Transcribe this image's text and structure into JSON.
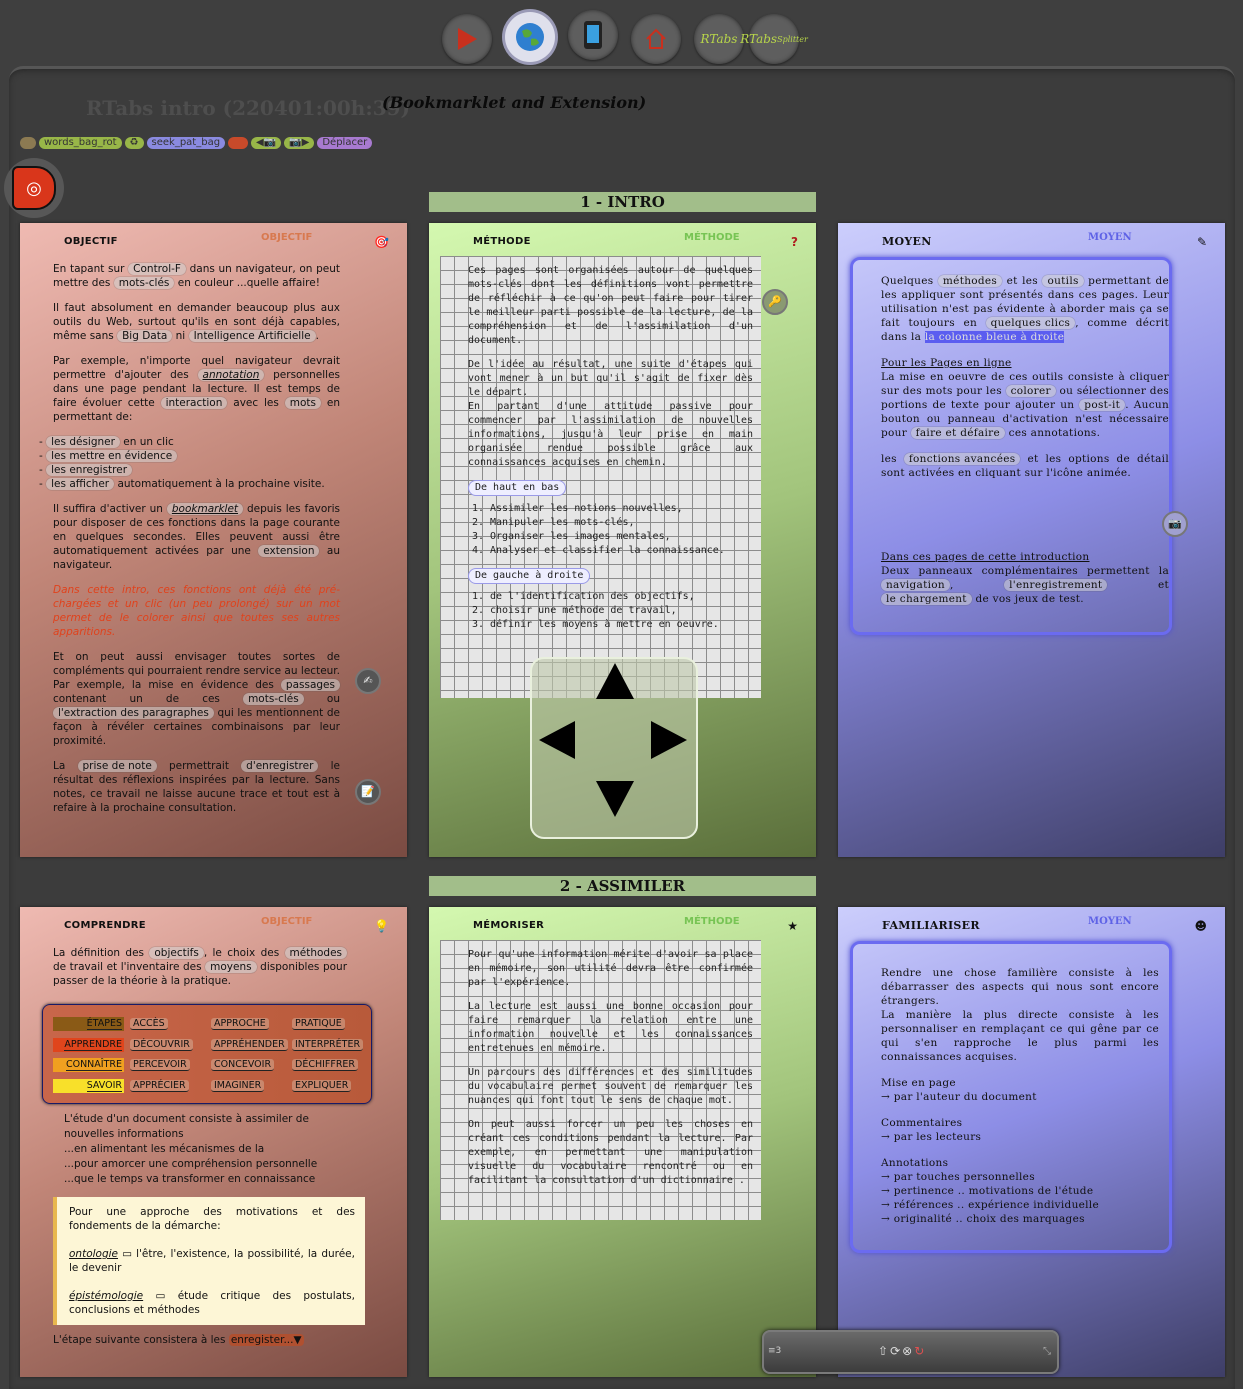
{
  "toolbar": {
    "buttons": [
      {
        "name": "play-button",
        "icon": "play-icon",
        "label": ""
      },
      {
        "name": "globe-button",
        "icon": "globe-icon",
        "label": ""
      },
      {
        "name": "phone-button",
        "icon": "phone-icon",
        "label": ""
      },
      {
        "name": "home-button",
        "icon": "home-icon",
        "label": ""
      },
      {
        "name": "rtabs-button",
        "label": "RTabs"
      },
      {
        "name": "rtabs-splitter-button",
        "label": "RTabs",
        "sup": "Splitter"
      }
    ]
  },
  "header": {
    "title": "RTabs intro (220401:00h:39)",
    "subtitle": "(Bookmarklet and Extension)"
  },
  "pillbar": {
    "words_bag": "words_bag_rot",
    "seek_pat": "seek_pat_bag",
    "move": "Déplacer"
  },
  "sections": {
    "s1": "1 - INTRO",
    "s2": "2 - ASSIMILER"
  },
  "panel_objectif": {
    "head": "OBJECTIF",
    "tag": "OBJECTIF",
    "p1a": "En tapant sur",
    "p1chip1": "Control-F",
    "p1b": "dans un navigateur, on peut mettre des",
    "p1chip2": "mots-clés",
    "p1c": "en couleur ...quelle affaire!",
    "p2a": "Il faut absolument en demander beaucoup plus aux outils du Web, surtout qu'ils en sont déjà capables, même sans",
    "p2chip1": "Big Data",
    "p2b": "ni",
    "p2chip2": "Intelligence Artificielle",
    "p2c": ".",
    "p3a": "Par exemple, n'importe quel navigateur devrait permettre d'ajouter des",
    "p3chip1": "annotation",
    "p3b": "personnelles dans une page pendant la lecture. Il est temps de faire évoluer cette",
    "p3chip2": "interaction",
    "p3c": "avec les",
    "p3chip3": "mots",
    "p3d": "en permettant de:",
    "list": [
      {
        "chip": "les désigner",
        "rest": "en un clic"
      },
      {
        "chip": "les mettre en évidence",
        "rest": ""
      },
      {
        "chip": "les enregistrer",
        "rest": ""
      },
      {
        "chip": "les afficher",
        "rest": "automatiquement à la prochaine visite."
      }
    ],
    "p4a": "Il suffira d'activer un",
    "p4chip1": "bookmarklet",
    "p4b": "depuis les favoris pour disposer de ces fonctions dans la page courante en quelques secondes. Elles peuvent aussi être automatiquement activées par une",
    "p4chip2": "extension",
    "p4c": "au navigateur.",
    "p5": "Dans cette intro, ces fonctions ont déjà été pré-chargées et un clic (un peu prolongé) sur un mot permet de le colorer ainsi que toutes ses autres apparitions.",
    "p6a": "Et on peut aussi envisager toutes sortes de compléments qui pourraient rendre service au lecteur. Par exemple, la mise en évidence des",
    "p6chip1": "passages",
    "p6b": "contenant un de ces",
    "p6chip2": "mots-clés",
    "p6c": "ou",
    "p6chip3": "l'extraction des paragraphes",
    "p6d": "qui les mentionnent de façon à révéler certaines combinaisons par leur proximité.",
    "p7a": "La",
    "p7chip1": "prise de note",
    "p7b": "permettrait",
    "p7chip2": "d'enregistrer",
    "p7c": "le résultat des réflexions inspirées par la lecture. Sans notes, ce travail ne laisse aucune trace et tout est à refaire à la prochaine consultation."
  },
  "panel_methode": {
    "head": "MÉTHODE",
    "tag": "MÉTHODE",
    "p1": "Ces pages sont organisées autour de quelques mots-clés dont les définitions vont permettre de réfléchir à ce qu'on peut faire pour tirer le meilleur parti possible de la lecture, de la compréhension et de l'assimilation d'un document.",
    "p2": "De l'idée au résultat, une suite d'étapes qui vont mener à un but qu'il s'agit de fixer dès le départ.",
    "p3": "En partant d'une attitude passive pour commencer par l'assimilation de nouvelles informations, jusqu'à leur prise en main organisée rendue possible grâce aux connaissances acquises en chemin.",
    "h1": "De haut en bas",
    "list1": [
      "Assimiler les notions nouvelles,",
      "Manipuler les mots-clés,",
      "Organiser les images mentales,",
      "Analyser et classifier la connaissance."
    ],
    "h2": "De gauche à droite",
    "list2": [
      "de l'identification des objectifs,",
      "choisir une méthode de travail,",
      "définir les moyens à mettre en oeuvre."
    ]
  },
  "panel_moyen": {
    "head": "MOYEN",
    "tag": "MOYEN",
    "p1a": "Quelques",
    "p1chip1": "méthodes",
    "p1b": "et les",
    "p1chip2": "outils",
    "p1c": "permettant de les appliquer sont présentés dans ces pages. Leur utilisation n'est pas évidente à aborder mais ça se fait toujours en",
    "p1chip3": "quelques clics",
    "p1d": ", comme décrit dans la",
    "p1hl": "la colonne bleue à droite",
    "h2": "Pour les Pages en ligne",
    "p2a": "La mise en oeuvre de ces outils consiste à cliquer sur des mots pour les",
    "p2chip1": "colorer",
    "p2b": "ou sélectionner des portions de texte pour ajouter un",
    "p2chip2": "post-it",
    "p2c": ". Aucun bouton ou panneau d'activation n'est nécessaire pour",
    "p2chip3": "faire et défaire",
    "p2d": "ces annotations.",
    "p3a": "les",
    "p3chip1": "fonctions avancées",
    "p3b": "et les options de détail sont activées en cliquant sur l'icône animée.",
    "h4": "Dans ces pages de cette introduction",
    "p4a": "Deux panneaux complémentaires permettent la",
    "p4chip1": "navigation",
    "p4b": ",",
    "p4chip2": "l'enregistrement",
    "p4c": "et",
    "p4chip3": "le chargement",
    "p4d": "de vos jeux de test."
  },
  "panel_comprendre": {
    "head": "COMPRENDRE",
    "tag": "OBJECTIF",
    "p1a": "La définition des",
    "p1chip1": "objectifs",
    "p1b": ", le choix des",
    "p1chip2": "méthodes",
    "p1c": "de travail et l'inventaire des",
    "p1chip3": "moyens",
    "p1d": "disponibles pour passer de la théorie à la pratique.",
    "table": [
      {
        "head": "ÉTAPES",
        "c1": "ACCÈS",
        "c2": "APPROCHE",
        "c3": "PRATIQUE",
        "color": "#8a5a16"
      },
      {
        "head": "APPRENDRE",
        "c1": "DÉCOUVRIR",
        "c2": "APPRÉHENDER",
        "c3": "INTERPRÉTER",
        "color": "#e0451c"
      },
      {
        "head": "CONNAÎTRE",
        "c1": "PERCEVOIR",
        "c2": "CONCEVOIR",
        "c3": "DÉCHIFFRER",
        "color": "#f0a020"
      },
      {
        "head": "SAVOIR",
        "c1": "APPRÉCIER",
        "c2": "IMAGINER",
        "c3": "EXPLIQUER",
        "color": "#f8e02a"
      }
    ],
    "lines": [
      "L'étude d'un document consiste à assimiler de nouvelles informations",
      "...en alimentant les mécanismes de la",
      "...pour amorcer une compréhension personnelle",
      "...que le temps va transformer en connaissance"
    ],
    "note_p1": "Pour une approche des motivations et des fondements de la démarche:",
    "note_t1": "ontologie",
    "note_d1": "l'être, l'existence, la possibilité, la durée, le devenir",
    "note_t2": "épistémologie",
    "note_d2": "étude critique des postulats, conclusions et méthodes",
    "next_a": "L'étape suivante consistera à les",
    "next_b": "enregister...▼"
  },
  "panel_memoriser": {
    "head": "MÉMORISER",
    "tag": "MÉTHODE",
    "p1": "Pour qu'une information mérite d'avoir sa place en mémoire, son utilité devra être confirmée par l'expérience.",
    "p2": "La lecture est aussi une bonne occasion pour faire remarquer la relation entre une information nouvelle et les connaissances entretenues en mémoire.",
    "p3": "Un parcours des différences et des similitudes du vocabulaire permet souvent de remarquer les nuances qui font tout le sens de chaque mot.",
    "p4": "On peut aussi forcer un peu les choses en créant ces conditions pendant la lecture. Par exemple, en permettant une manipulation visuelle du vocabulaire rencontré ou en facilitant la consultation d'un dictionnaire ."
  },
  "panel_familiariser": {
    "head": "FAMILIARISER",
    "tag": "MOYEN",
    "p1": "Rendre une chose familière consiste à les débarrasser des aspects qui nous sont encore étrangers.",
    "p1b": "La manière la plus directe consiste à les personnaliser en remplaçant ce qui gêne par ce qui s'en rapproche le plus parmi les connaissances acquises.",
    "h2": "Mise en page",
    "l2": "→ par l'auteur du document",
    "h3": "Commentaires",
    "l3": "→ par les lecteurs",
    "h4": "Annotations",
    "l4": [
      "→ par touches personnelles",
      "→ pertinence .. motivations de l'étude",
      "→ références .. expérience individuelle",
      "→ originalité .. choix des marquages"
    ]
  },
  "bottombar": {
    "left": "≡3"
  }
}
